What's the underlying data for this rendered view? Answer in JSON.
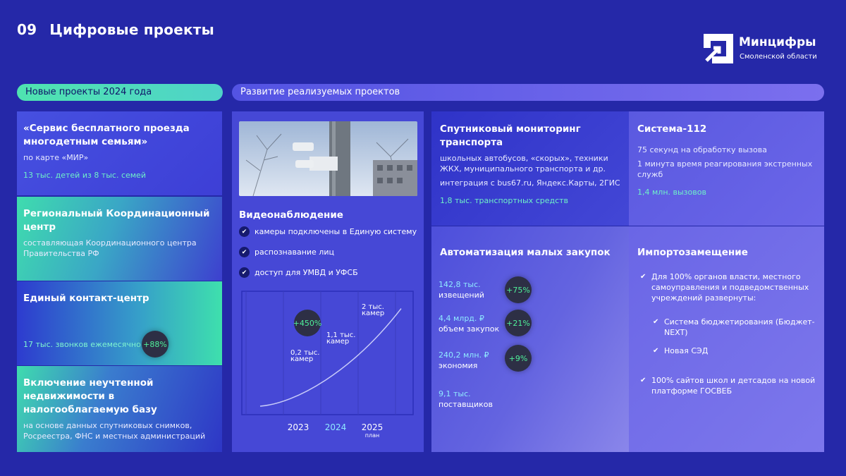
{
  "header": {
    "number": "09",
    "title": "Цифровые проекты"
  },
  "logo": {
    "name": "Минцифры",
    "sub": "Смоленской области"
  },
  "pills": {
    "new": "Новые проекты 2024 года",
    "dev": "Развитие реализуемых проектов"
  },
  "left": [
    {
      "title": "«Сервис бесплатного проезда многодетным семьям»",
      "sub": "по карте «МИР»",
      "highlight": "13 тыс. детей из 8 тыс. семей"
    },
    {
      "title": "Региональный Координационный центр",
      "sub": "составляющая Координационного центра Правительства РФ"
    },
    {
      "title": "Единый контакт-центр",
      "highlight": "17 тыс. звонков ежемесячно",
      "badge": "+88%"
    },
    {
      "title": "Включение неучтенной недвижимости в налогооблагаемую базу",
      "sub": "на основе данных спутниковых снимков, Росреестра, ФНС и местных администраций"
    }
  ],
  "video": {
    "title": "Видеонаблюдение",
    "items": [
      "камеры подключены в Единую систему",
      "распознавание лиц",
      "доступ для УМВД и УФСБ"
    ]
  },
  "chart_data": {
    "type": "line",
    "categories": [
      "2023",
      "2024",
      "2025"
    ],
    "x_note": "план",
    "labels": [
      "0,2 тыс. камер",
      "1,1 тыс. камер",
      "2 тыс. камер"
    ],
    "values": [
      0.2,
      1.1,
      2
    ],
    "growth": "+450%"
  },
  "sat": {
    "title": "Спутниковый мониторинг транспорта",
    "desc": "школьных автобусов, «скорых», техники ЖКХ, муниципального транспорта и др.",
    "integr": "интеграция с bus67.ru, Яндекс.Карты, 2ГИС",
    "highlight": "1,8 тыс. транспортных средств"
  },
  "s112": {
    "title": "Система-112",
    "l1": "75 секунд на обработку вызова",
    "l2": "1 минута время реагирования экстренных служб",
    "highlight": "1,4 млн. вызовов"
  },
  "auto": {
    "title": "Автоматизация малых закупок",
    "rows": [
      {
        "v": "142,8 тыс.",
        "l": "извещений",
        "b": "+75%"
      },
      {
        "v": "4,4 млрд. ₽",
        "l": "объем закупок",
        "b": "+21%"
      },
      {
        "v": "240,2 млн. ₽",
        "l": "экономия",
        "b": "+9%"
      },
      {
        "v": "9,1 тыс.",
        "l": "поставщиков"
      }
    ]
  },
  "imp": {
    "title": "Импортозамещение",
    "p1": "Для 100% органов власти, местного самоуправления и подведомственных учреждений развернуты:",
    "sub1": "Система бюджетирования (Бюджет-NEXT)",
    "sub2": "Новая СЭД",
    "p2": "100% сайтов школ и детсадов на новой платформе ГОСВЕБ"
  },
  "colors": {
    "bg": "#2528a8",
    "accent": "#4fe3b0",
    "badge_text": "#4ff09a"
  }
}
